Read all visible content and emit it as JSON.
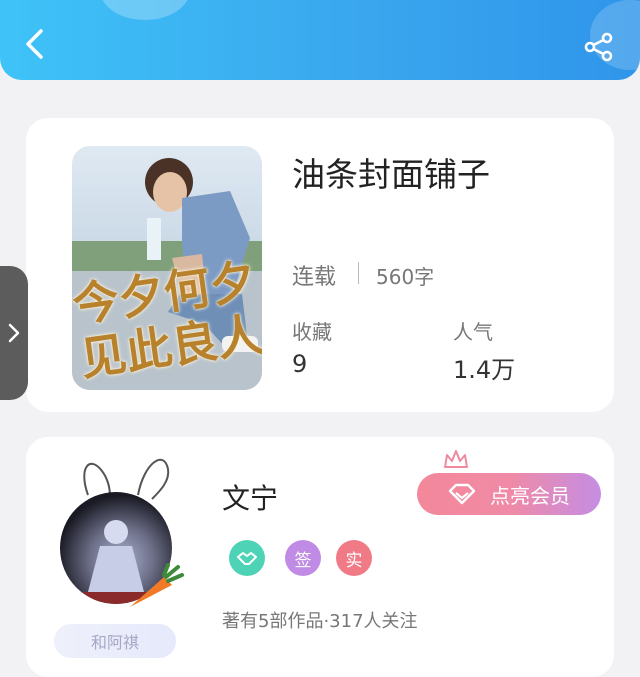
{
  "header": {
    "back_icon": "chevron-left-icon",
    "share_icon": "share-icon",
    "colors": {
      "start": "#3ec3f8",
      "end": "#2f95ea"
    }
  },
  "side_tab": {
    "icon": "chevron-right-icon"
  },
  "book": {
    "cover_title": "今夕何夕见此良人",
    "title": "油条封面铺子",
    "status": "连载",
    "words": "560字",
    "favorites_label": "收藏",
    "favorites_value": "9",
    "popularity_label": "人气",
    "popularity_value": "1.4万"
  },
  "author": {
    "name": "文宁",
    "vip_label": "点亮会员",
    "badges": [
      "签",
      "实"
    ],
    "badge_icons": [
      "handshake-icon"
    ],
    "info": "著有5部作品·317人关注",
    "name_tag": "和阿祺",
    "vip_colors": {
      "start": "#f3889a",
      "end": "#c58de4"
    }
  }
}
